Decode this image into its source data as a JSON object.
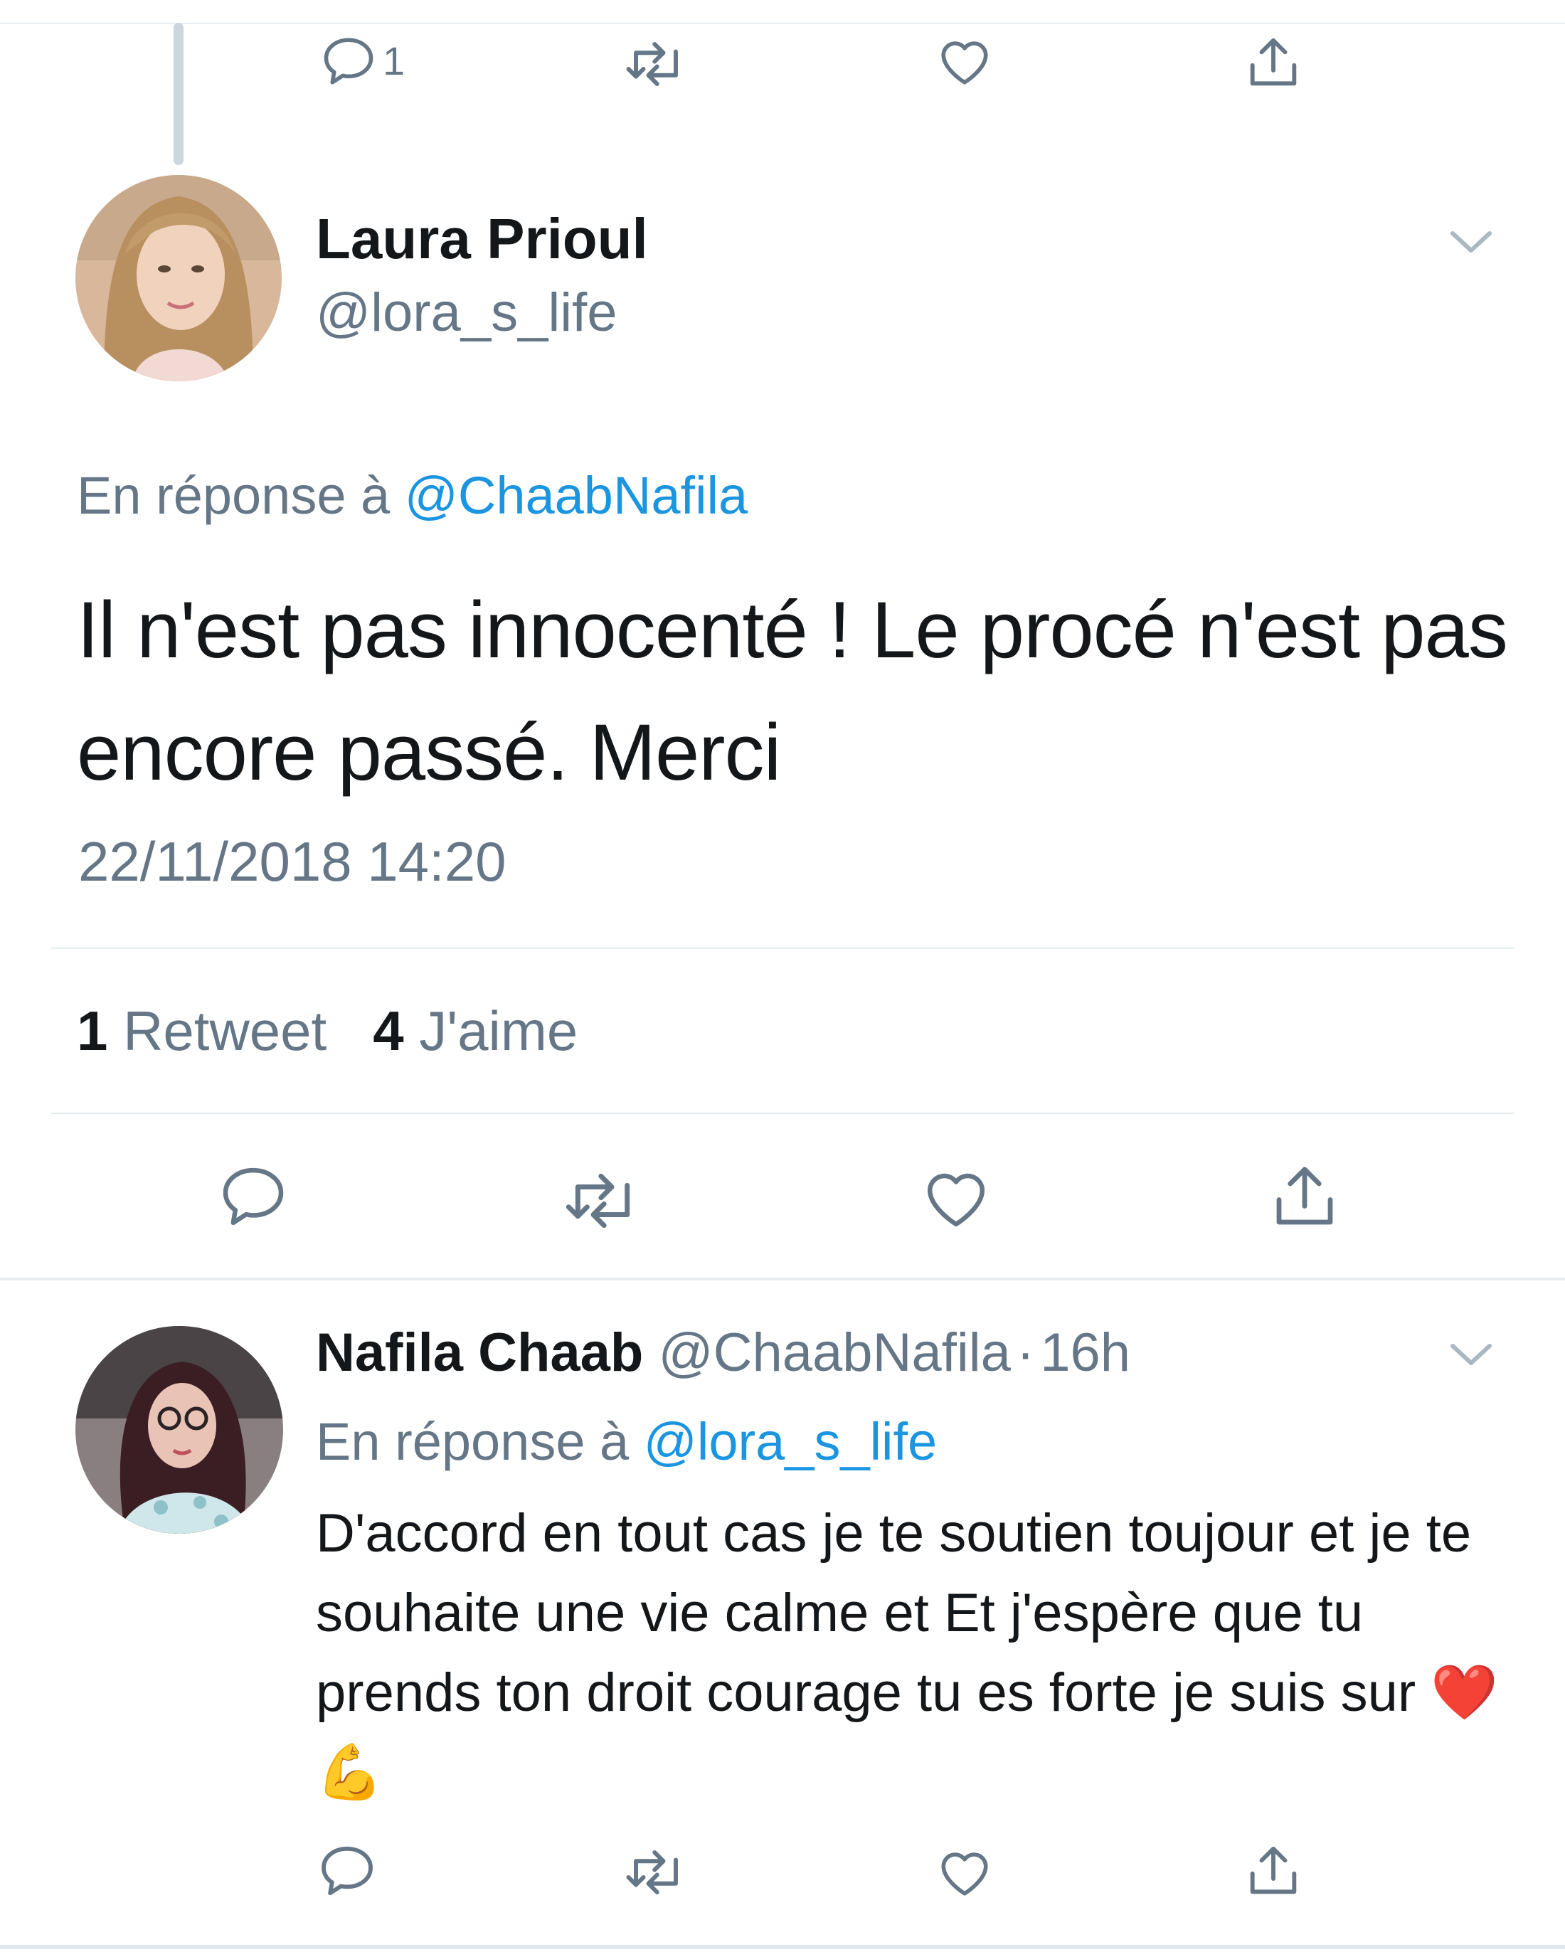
{
  "top_actions": {
    "reply_count": "1"
  },
  "main_tweet": {
    "author_name": "Laura Prioul",
    "author_handle": "@lora_s_life",
    "reply_prefix": "En réponse à",
    "reply_mention": "@ChaabNafila",
    "text": "Il n'est pas innocenté ! Le procé n'est pas encore passé. Merci",
    "datetime": "22/11/2018 14:20",
    "retweet_count": "1",
    "retweet_label": "Retweet",
    "like_count": "4",
    "like_label": "J'aime"
  },
  "reply_tweet": {
    "author_name": "Nafila Chaab",
    "author_handle": "@ChaabNafila",
    "separator": "·",
    "time": "16h",
    "reply_prefix": "En réponse à",
    "reply_mention": "@lora_s_life",
    "text": "D'accord en tout cas je te soutien toujour et je te souhaite une vie calme et Et j'espère que tu prends ton droit courage tu es forte je suis sur",
    "emoji": "❤️ 💪"
  },
  "colors": {
    "accent": "#1b95e0",
    "secondary_text": "#657786",
    "icon": "#657786",
    "divider": "#e6ecf0"
  }
}
